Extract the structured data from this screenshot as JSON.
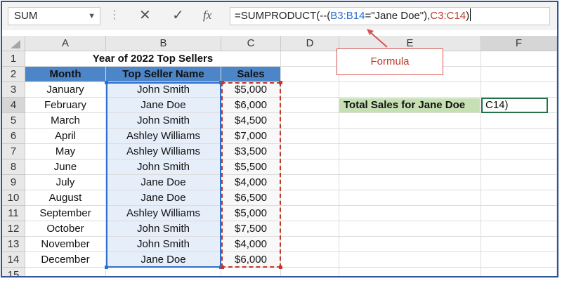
{
  "formula_bar": {
    "name_box": "SUM",
    "cancel_icon": "✕",
    "enter_icon": "✓",
    "function_icon": "fx",
    "formula_parts": [
      "=SUMPRODUCT(--(",
      "B3:B14",
      "=\"Jane Doe\"),",
      "C3:C14",
      ")"
    ]
  },
  "columns": [
    "A",
    "B",
    "C",
    "D",
    "E",
    "F"
  ],
  "rows": [
    "1",
    "2",
    "3",
    "4",
    "5",
    "6",
    "7",
    "8",
    "9",
    "10",
    "11",
    "12",
    "13",
    "14",
    "15"
  ],
  "sheet": {
    "title": "Year of 2022 Top Sellers",
    "headers": [
      "Month",
      "Top Seller Name",
      "Sales"
    ],
    "data": [
      [
        "January",
        "John Smith",
        "$5,000"
      ],
      [
        "February",
        "Jane Doe",
        "$6,000"
      ],
      [
        "March",
        "John Smith",
        "$4,500"
      ],
      [
        "April",
        "Ashley Williams",
        "$7,000"
      ],
      [
        "May",
        "Ashley Williams",
        "$3,500"
      ],
      [
        "June",
        "John Smith",
        "$5,500"
      ],
      [
        "July",
        "Jane Doe",
        "$4,000"
      ],
      [
        "August",
        "Jane Doe",
        "$6,500"
      ],
      [
        "September",
        "Ashley Williams",
        "$5,000"
      ],
      [
        "October",
        "John Smith",
        "$7,500"
      ],
      [
        "November",
        "John Smith",
        "$4,000"
      ],
      [
        "December",
        "Jane Doe",
        "$6,000"
      ]
    ],
    "label": "Total Sales for Jane Doe",
    "active_cell_text": "C14)"
  },
  "callout": {
    "text": "Formula"
  },
  "colors": {
    "header_fill": "#4d86c8",
    "label_fill": "#c6e0b4",
    "range_blue": "#2e6fd0",
    "range_red": "#c0392b",
    "active_border": "#217346"
  }
}
